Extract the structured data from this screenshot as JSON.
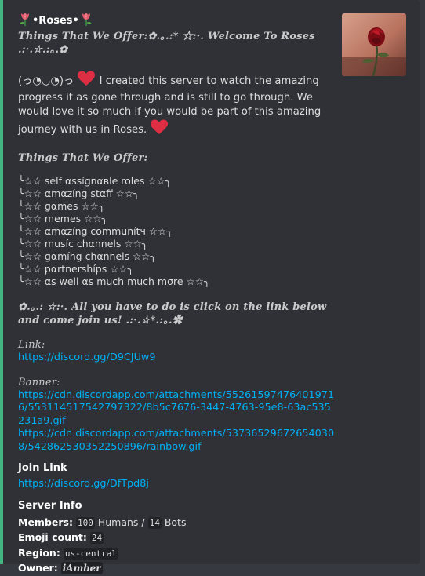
{
  "embed": {
    "accent_color": "#43b581",
    "author": {
      "name": "•Roses•",
      "icon": "tulip-icon"
    },
    "thumbnail": {
      "icon": "rose-image"
    },
    "title_line1": "Things That We Offer:✿.｡.:* ☆:·. Welcome To Roses",
    "title_line2": ".:·.☆.:｡.✿",
    "intro_face": "(っ◔◡◔)っ",
    "intro_text": "I created this server to watch the amazing progress it as gone through and is still to go through. We would love it so much if you would be part of this amazing journey with us in Roses.",
    "offer_heading": "Things That We Offer:",
    "offers": [
      "╰☆☆ self αssígnαвle roles ☆☆╮",
      "╰☆☆ αmαzíng stαff ☆☆╮",
      "╰☆☆ gαmes ☆☆╮",
      "╰☆☆ memes ☆☆╮",
      "╰☆☆ αmαzíng communítч ☆☆╮",
      "╰☆☆ musíc chαnnels ☆☆╮",
      "╰☆☆ gαmíng chαnnels ☆☆╮",
      "╰☆☆ pαrtnershíps ☆☆╮",
      "╰☆☆ αs well αs much much mσre ☆☆╮"
    ],
    "call_line1": "✿.｡.: ☆:·. All you have to do is click on the link below",
    "call_line2": "and come join us! .:·.☆*.:｡.✿",
    "link_label": "Link:",
    "link_url": "https://discord.gg/D9CJUw9",
    "banner_label": "Banner:",
    "banner_urls": [
      "https://cdn.discordapp.com/attachments/552615974764019716/553114517542797322/8b5c7676-3447-4763-95e8-63ac535231a9.gif",
      "https://cdn.discordapp.com/attachments/537365296726540308/542862530352250896/rainbow.gif"
    ],
    "fields": {
      "join_name": "Join Link",
      "join_url": "https://discord.gg/DfTpd8j",
      "info_name": "Server Info",
      "members_label": "Members:",
      "humans_count": "100",
      "humans_label": "Humans /",
      "bots_count": "14",
      "bots_label": "Bots",
      "emoji_label": "Emoji count:",
      "emoji_count": "24",
      "region_label": "Region:",
      "region_value": "us-central",
      "owner_label": "Owner:",
      "owner_value": "iAmber"
    }
  }
}
